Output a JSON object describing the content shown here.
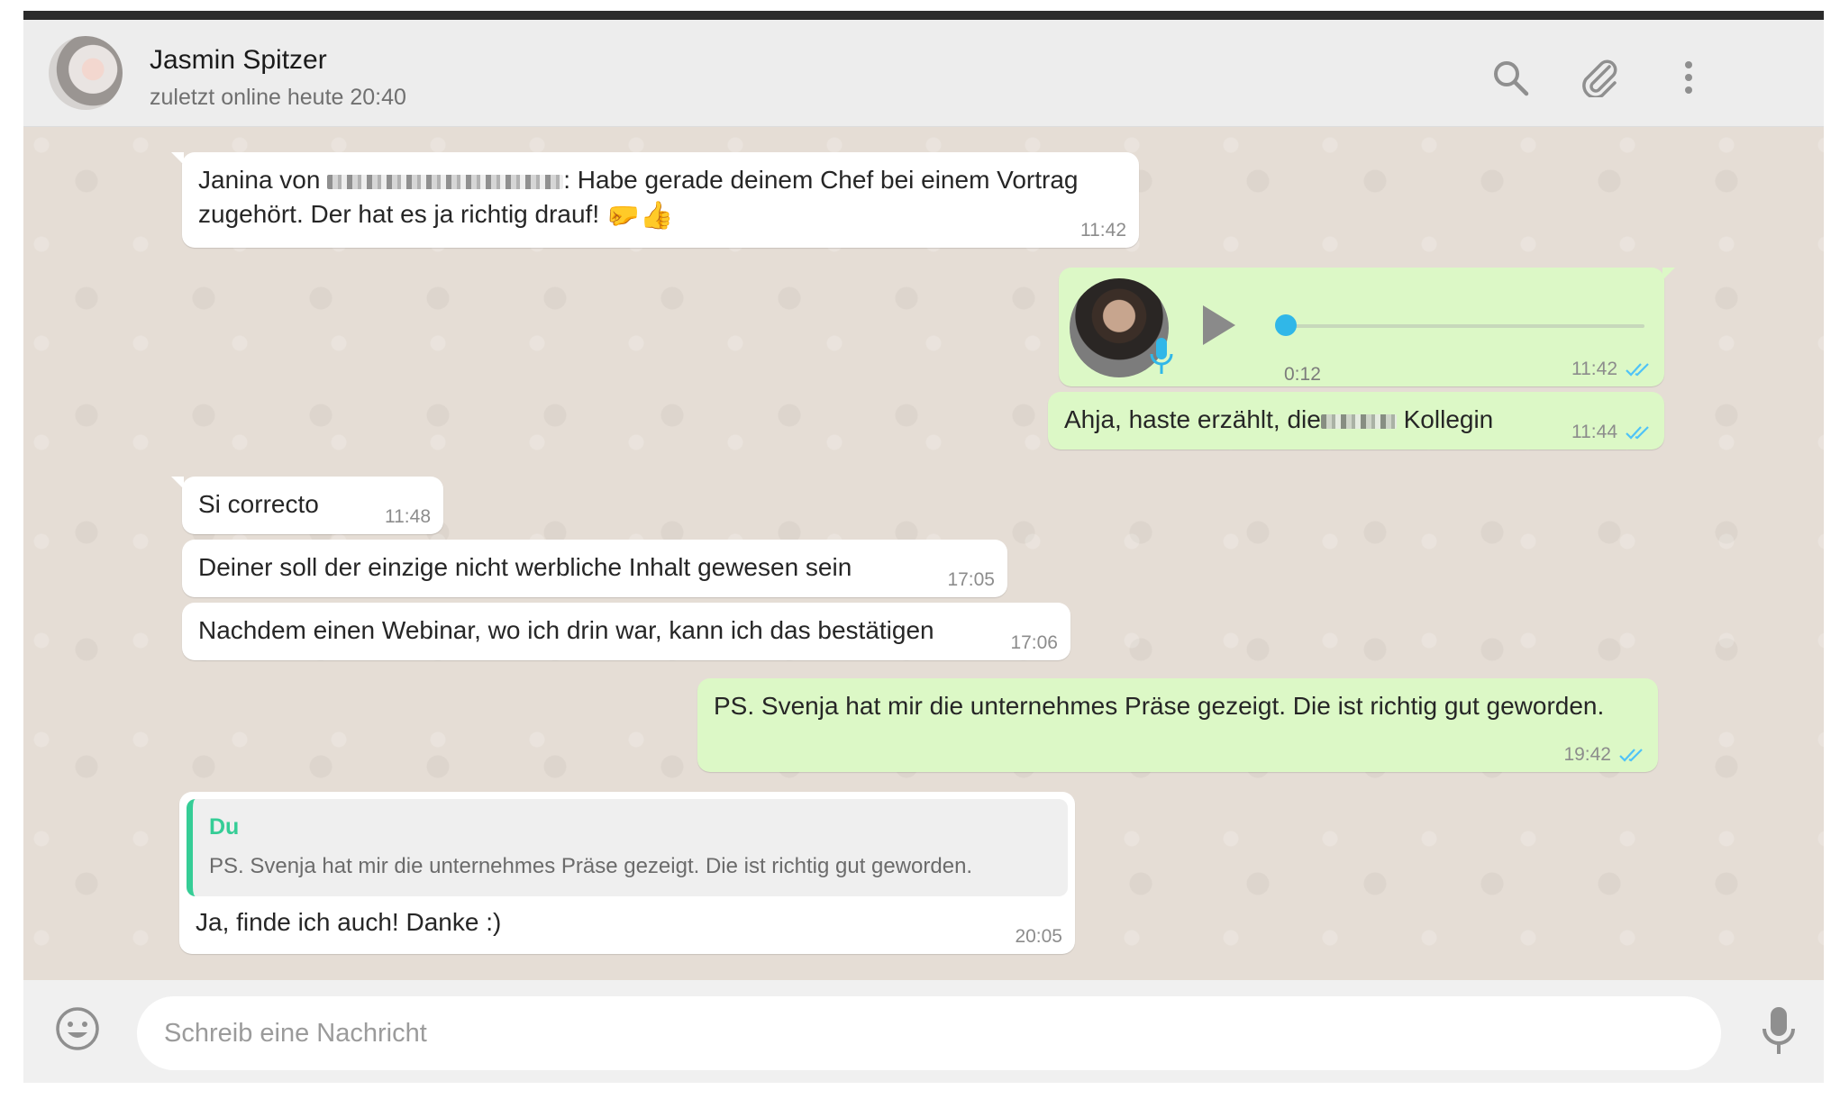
{
  "header": {
    "contact_name": "Jasmin Spitzer",
    "status": "zuletzt online heute 20:40",
    "icons": [
      "search-icon",
      "attach-icon",
      "menu-icon"
    ]
  },
  "messages": [
    {
      "dir": "in",
      "text_prefix": "Janina von ",
      "text_suffix": ": Habe gerade deinem Chef bei einem Vortrag",
      "text_line2": "zugehört. Der hat es ja richtig drauf! ",
      "emojis": "🤛👍",
      "time": "11:42"
    },
    {
      "dir": "out",
      "type": "voice",
      "duration": "0:12",
      "time": "11:42",
      "read": true
    },
    {
      "dir": "out",
      "text_prefix": "Ahja, haste erzählt, die",
      "text_suffix": " Kollegin",
      "time": "11:44",
      "read": true
    },
    {
      "dir": "in",
      "text": "Si correcto",
      "time": "11:48"
    },
    {
      "dir": "in",
      "text": "Deiner soll der einzige nicht werbliche Inhalt gewesen sein",
      "time": "17:05"
    },
    {
      "dir": "in",
      "text": "Nachdem einen Webinar, wo ich drin war, kann ich das bestätigen",
      "time": "17:06"
    },
    {
      "dir": "out",
      "text": "PS. Svenja hat mir die unternehmes Präse gezeigt. Die ist richtig gut geworden.",
      "time": "19:42",
      "read": true
    },
    {
      "dir": "in",
      "quote_author": "Du",
      "quote_text": "PS. Svenja hat mir die unternehmes Präse gezeigt. Die ist richtig gut geworden.",
      "text": "Ja, finde ich auch! Danke :)",
      "time": "20:05"
    }
  ],
  "composer": {
    "placeholder": "Schreib eine Nachricht"
  },
  "colors": {
    "chat_bg": "#e5ddd5",
    "incoming": "#ffffff",
    "outgoing": "#dcf8c6",
    "read_ticks": "#4fc3f7",
    "quote_accent": "#35cd96"
  }
}
